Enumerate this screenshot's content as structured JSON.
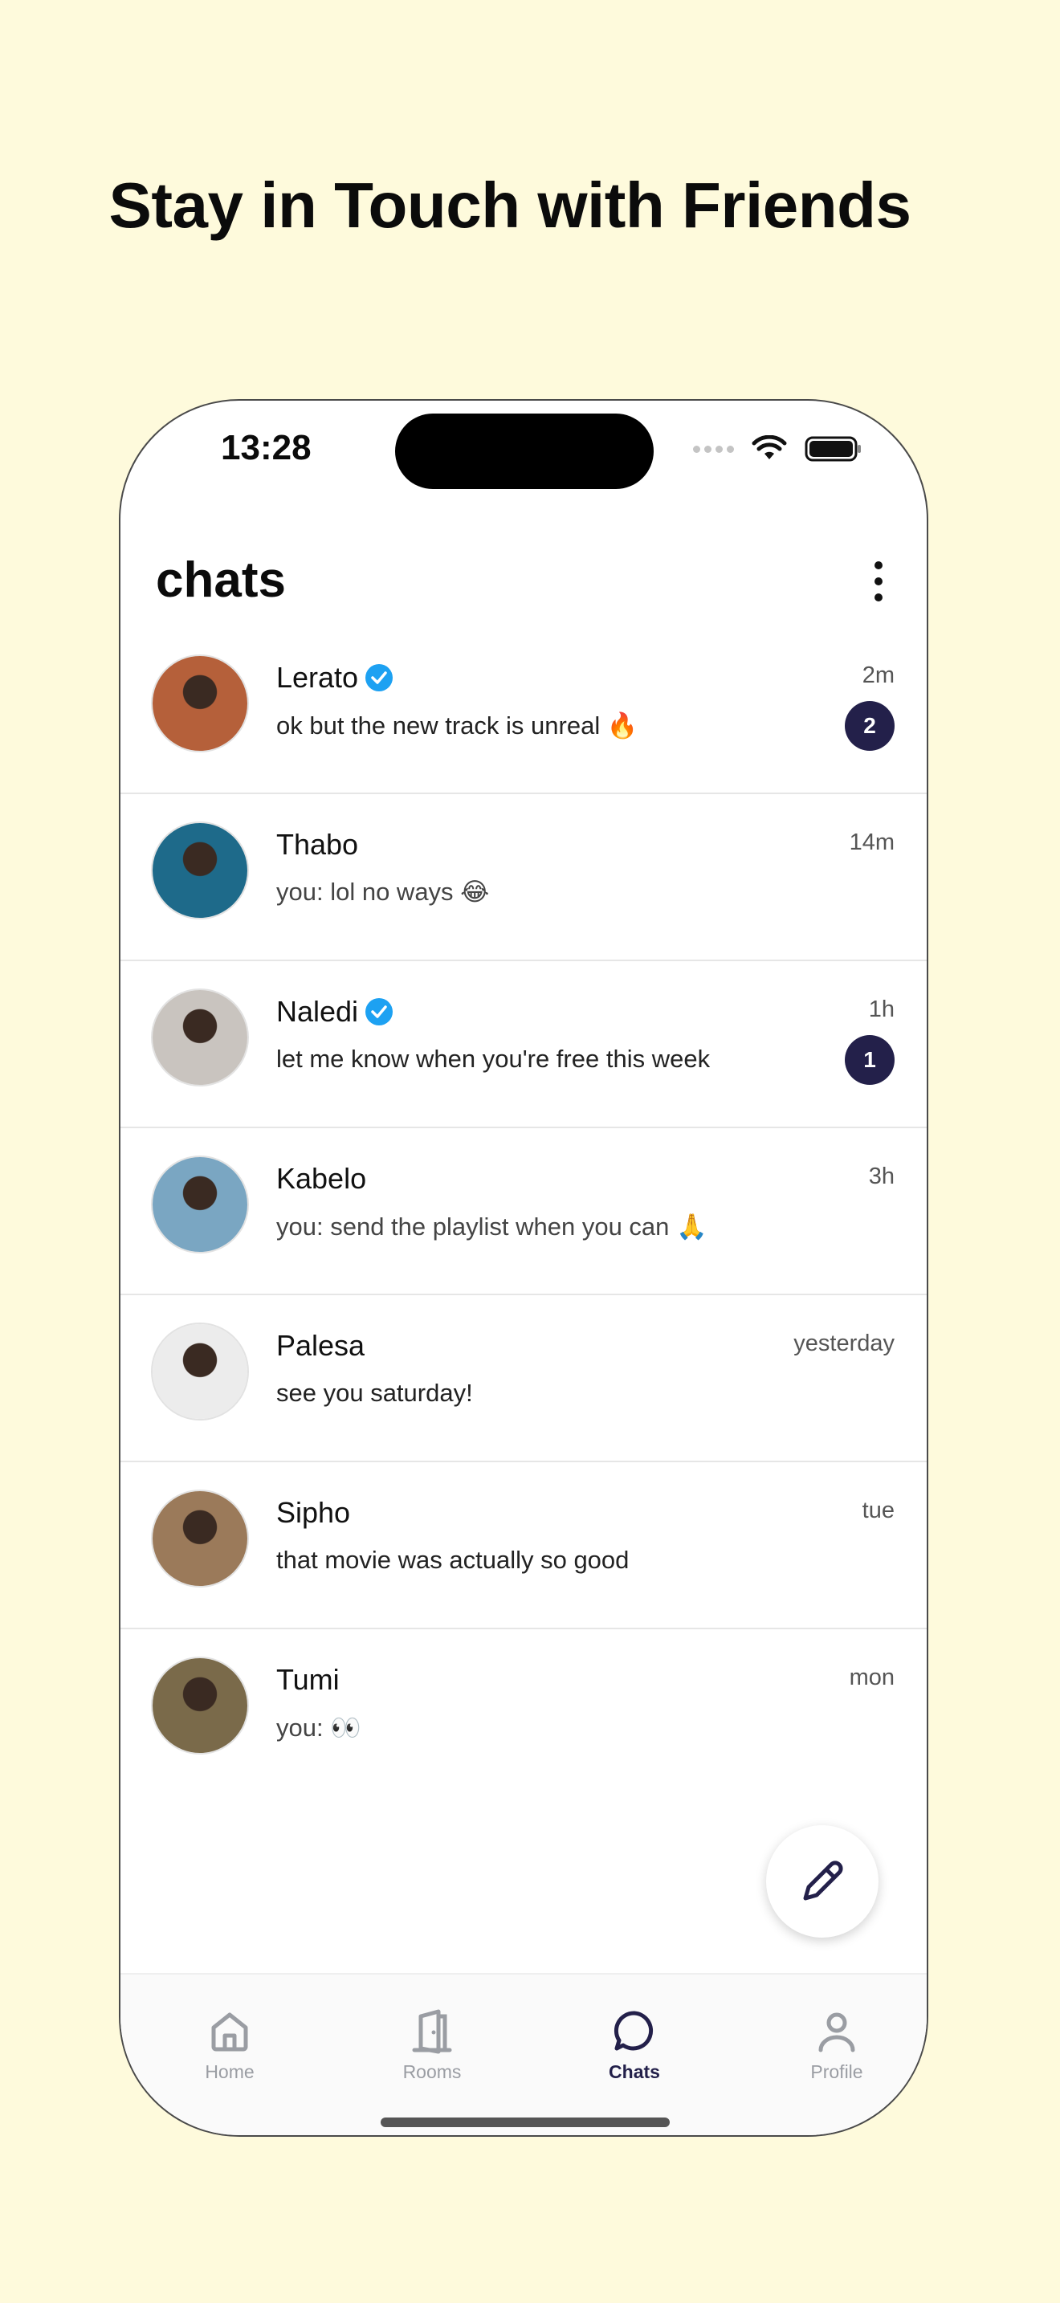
{
  "headline": "Stay in Touch with Friends",
  "status_bar": {
    "time": "13:28"
  },
  "app": {
    "title": "chats"
  },
  "colors": {
    "background": "#fefadc",
    "accent": "#23204a",
    "verified": "#1da1f2"
  },
  "chats": [
    {
      "name": "Lerato",
      "verified": true,
      "message": "ok but the new track is unreal 🔥",
      "time": "2m",
      "unread": "2",
      "avatar_color": "#b5603a"
    },
    {
      "name": "Thabo",
      "verified": false,
      "message": "you: lol no ways 😂",
      "time": "14m",
      "unread": null,
      "avatar_color": "#1e6a8a"
    },
    {
      "name": "Naledi",
      "verified": true,
      "message": "let me know when you're free this week",
      "time": "1h",
      "unread": "1",
      "avatar_color": "#c9c4bf"
    },
    {
      "name": "Kabelo",
      "verified": false,
      "message": "you: send the playlist when you can 🙏",
      "time": "3h",
      "unread": null,
      "avatar_color": "#7aa6c2"
    },
    {
      "name": "Palesa",
      "verified": false,
      "message": "see you saturday!",
      "time": "yesterday",
      "unread": null,
      "avatar_color": "#ececec"
    },
    {
      "name": "Sipho",
      "verified": false,
      "message": "that movie was actually so good",
      "time": "tue",
      "unread": null,
      "avatar_color": "#9b7a5a"
    },
    {
      "name": "Tumi",
      "verified": false,
      "message": "you: 👀",
      "time": "mon",
      "unread": null,
      "avatar_color": "#7a6a4a"
    }
  ],
  "tabs": [
    {
      "label": "Home",
      "icon": "home-icon",
      "active": false
    },
    {
      "label": "Rooms",
      "icon": "door-icon",
      "active": false
    },
    {
      "label": "Chats",
      "icon": "chat-bubble-icon",
      "active": true
    },
    {
      "label": "Profile",
      "icon": "person-icon",
      "active": false
    }
  ]
}
